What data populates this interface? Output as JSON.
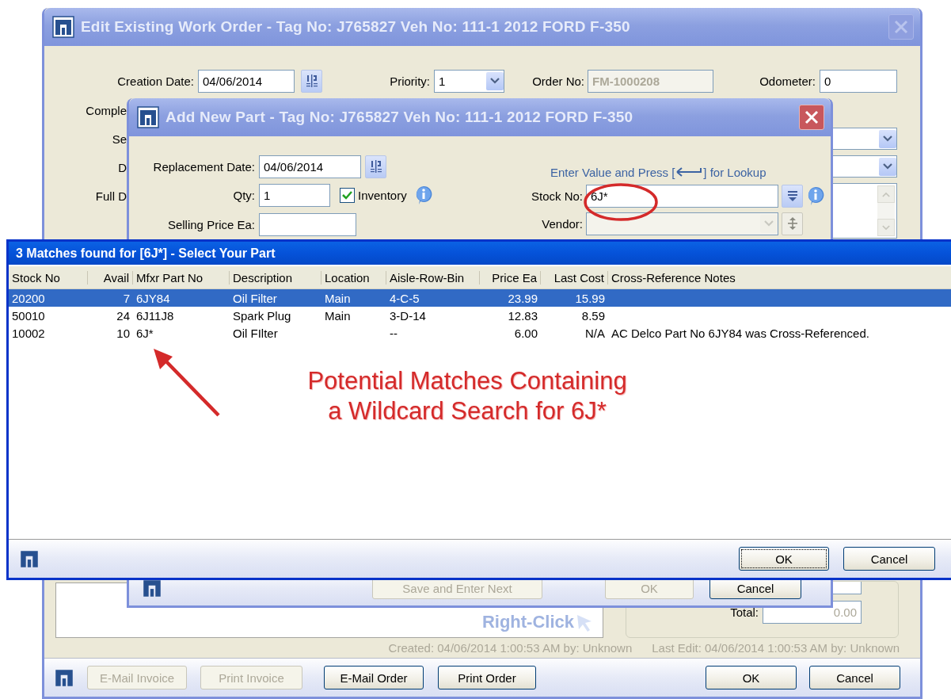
{
  "edit_window": {
    "title": "Edit Existing Work Order - Tag No: J765827 Veh No: 111-1 2012 FORD F-350",
    "creation_date": {
      "label": "Creation Date:",
      "value": "04/06/2014"
    },
    "priority": {
      "label": "Priority:",
      "value": "1"
    },
    "order_no": {
      "label": "Order No:",
      "value": "FM-1000208",
      "disabled": true
    },
    "odometer": {
      "label": "Odometer:",
      "value": "0"
    },
    "partial_labels": [
      "Comple",
      "Se",
      "D",
      "Full D"
    ],
    "notes_hint": "Right-Click",
    "total": {
      "label": "Total:",
      "value": "0.00"
    },
    "created": "Created: 04/06/2014 1:00:53 AM by: Unknown",
    "last_edit": "Last Edit: 04/06/2014 1:00:53 AM by: Unknown",
    "buttons": [
      {
        "label": "E-Mail Invoice",
        "disabled": true
      },
      {
        "label": "Print Invoice",
        "disabled": true
      },
      {
        "label": "E-Mail Order",
        "disabled": false
      },
      {
        "label": "Print Order",
        "disabled": false
      },
      {
        "label": "OK",
        "disabled": false
      },
      {
        "label": "Cancel",
        "disabled": false
      }
    ]
  },
  "add_part_window": {
    "title": "Add New Part - Tag No: J765827 Veh No: 111-1 2012 FORD F-350",
    "replacement_date": {
      "label": "Replacement Date:",
      "value": "04/06/2014"
    },
    "qty": {
      "label": "Qty:",
      "value": "1"
    },
    "inventory": {
      "label": "Inventory",
      "checked": true
    },
    "selling_price": {
      "label": "Selling Price Ea:"
    },
    "lookup_hint": {
      "before": "Enter Value and Press [",
      "after": "] for Lookup"
    },
    "stock_no": {
      "label": "Stock No:",
      "value": "6J*"
    },
    "vendor": {
      "label": "Vendor:",
      "disabled": true
    },
    "buttons": [
      {
        "label": "Save and Enter Next",
        "disabled": true
      },
      {
        "label": "OK",
        "disabled": true
      },
      {
        "label": "Cancel",
        "disabled": false
      }
    ]
  },
  "matches_window": {
    "title": "3 Matches found for [6J*] - Select Your Part",
    "columns": [
      {
        "label": "Stock No",
        "kind": "text"
      },
      {
        "label": "Avail",
        "kind": "number"
      },
      {
        "label": "Mfxr Part No",
        "kind": "text"
      },
      {
        "label": "Description",
        "kind": "text"
      },
      {
        "label": "Location",
        "kind": "text"
      },
      {
        "label": "Aisle-Row-Bin",
        "kind": "text"
      },
      {
        "label": "Price Ea",
        "kind": "number"
      },
      {
        "label": "Last Cost",
        "kind": "number"
      },
      {
        "label": "Cross-Reference Notes",
        "kind": "text"
      }
    ],
    "rows": [
      {
        "selected": true,
        "cells": [
          "20200",
          "7",
          "6JY84",
          "Oil Filter",
          "Main",
          "4-C-5",
          "23.99",
          "15.99",
          null
        ]
      },
      {
        "selected": false,
        "cells": [
          "50010",
          "24",
          "6J11J8",
          "Spark Plug",
          "Main",
          "3-D-14",
          "12.83",
          "8.59",
          null
        ]
      },
      {
        "selected": false,
        "cells": [
          "10002",
          "10",
          "6J*",
          "Oil FIlter",
          null,
          "--",
          "6.00",
          "N/A",
          "AC Delco Part No 6JY84 was Cross-Referenced."
        ]
      }
    ],
    "buttons": [
      {
        "label": "OK",
        "focused": true
      },
      {
        "label": "Cancel",
        "focused": false
      }
    ]
  },
  "annotation": {
    "lines": [
      "Potential Matches Containing",
      "a Wildcard Search for 6J*"
    ]
  }
}
